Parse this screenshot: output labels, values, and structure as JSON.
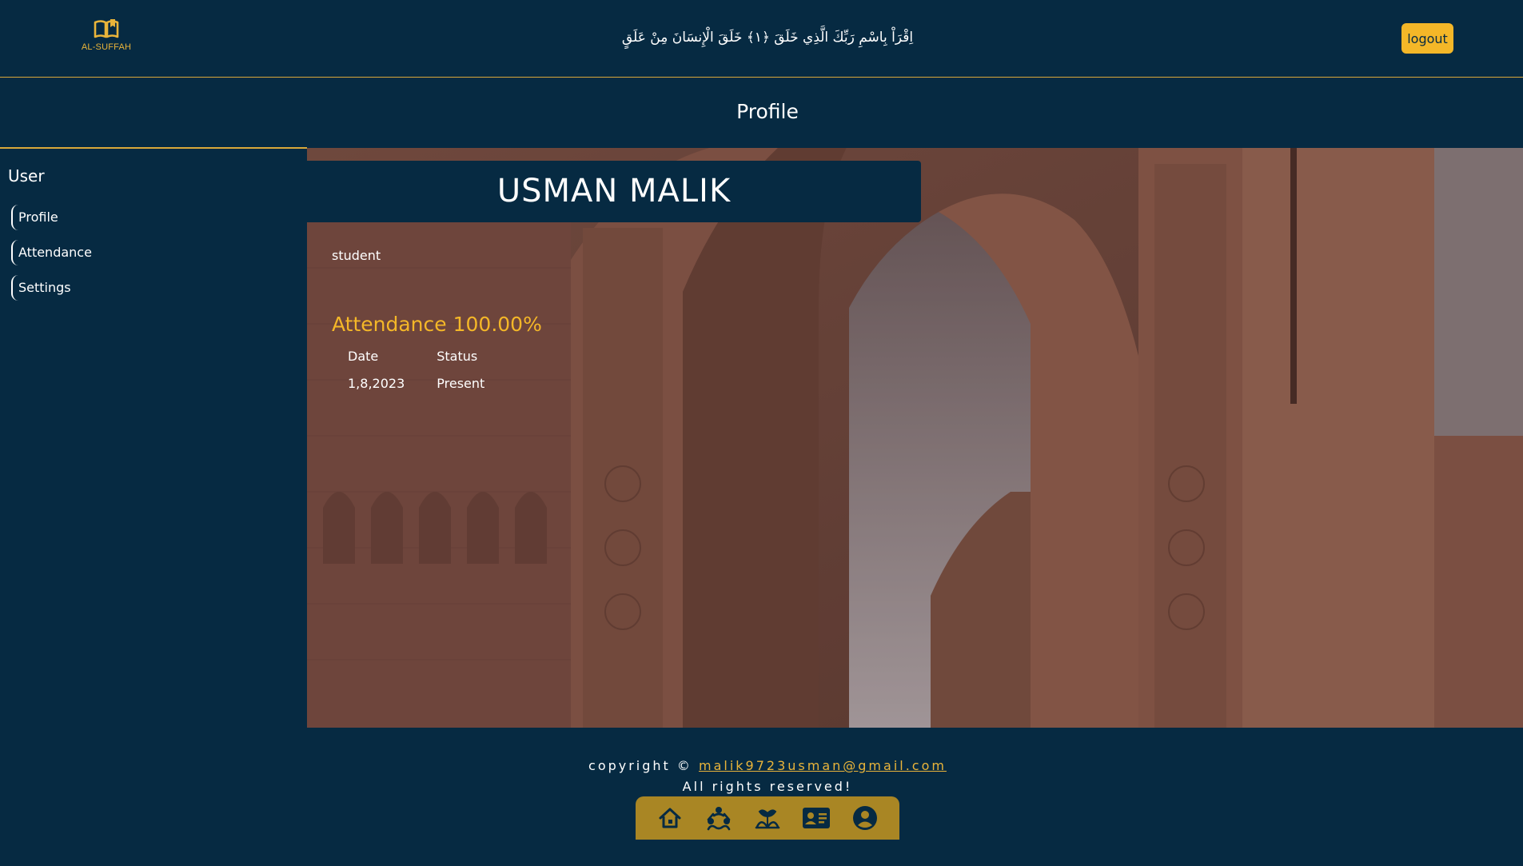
{
  "header": {
    "logo_text": "AL-SUFFAH",
    "verse": "اِقْرَاْ بِاسْمِ رَبِّكَ الَّذِي خَلَقَ ﴿١﴾ خَلَقَ الْإِنسَانَ مِنْ عَلَقٍ",
    "logout_label": "logout"
  },
  "page_title": "Profile",
  "sidebar": {
    "heading": "User",
    "items": [
      {
        "label": "Profile"
      },
      {
        "label": "Attendance"
      },
      {
        "label": "Settings"
      }
    ]
  },
  "profile": {
    "name": "USMAN MALIK",
    "role": "student",
    "attendance_title": "Attendance 100.00%",
    "attendance_table": {
      "headers": [
        "Date",
        "Status"
      ],
      "rows": [
        [
          "1,8,2023",
          "Present"
        ]
      ]
    }
  },
  "footer": {
    "copyright_prefix": "copyright ©",
    "email": "malik9723usman@gmail.com",
    "rights": "All rights reserved!"
  },
  "bottom_nav": {
    "icons": [
      "home-icon",
      "community-icon",
      "plant-icon",
      "contact-card-icon",
      "user-circle-icon"
    ]
  },
  "colors": {
    "background": "#062a42",
    "accent": "#f4b728",
    "nav_bar": "#a98624"
  }
}
